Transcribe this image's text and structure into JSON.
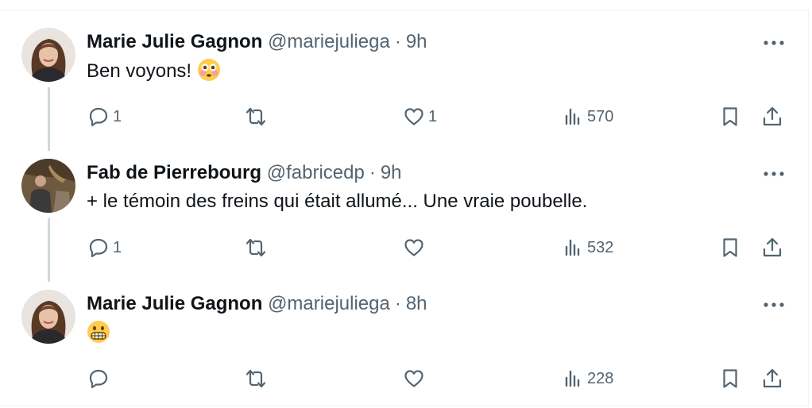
{
  "tweets": [
    {
      "name": "Marie Julie Gagnon",
      "handle": "@mariejuliega",
      "separator": "·",
      "time": "9h",
      "text": "Ben voyons! ",
      "emoji": "flushed-face-emoji",
      "replies": "1",
      "retweets": "",
      "likes": "1",
      "views": "570",
      "avatar": "woman-portrait"
    },
    {
      "name": "Fab de Pierrebourg",
      "handle": "@fabricedp",
      "separator": "·",
      "time": "9h",
      "text": "+ le témoin des freins qui était allumé...  Une vraie poubelle.",
      "emoji": "",
      "replies": "1",
      "retweets": "",
      "likes": "",
      "views": "532",
      "avatar": "man-outdoor-portrait"
    },
    {
      "name": "Marie Julie Gagnon",
      "handle": "@mariejuliega",
      "separator": "·",
      "time": "8h",
      "text": "",
      "emoji": "grimacing-face-emoji",
      "replies": "",
      "retweets": "",
      "likes": "",
      "views": "228",
      "avatar": "woman-portrait"
    }
  ],
  "colors": {
    "text": "#0f1419",
    "secondary": "#536471",
    "thread": "#cfd9de",
    "border": "#eff3f4"
  }
}
